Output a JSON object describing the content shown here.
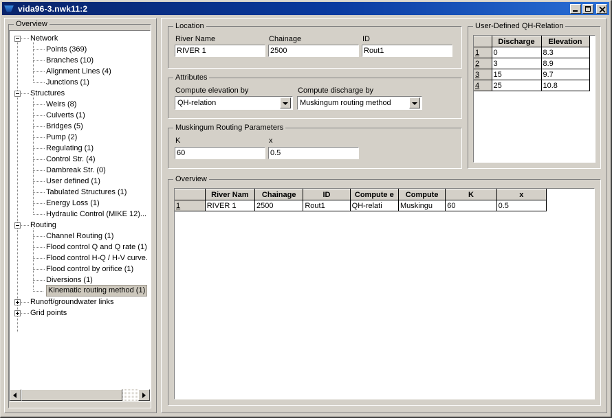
{
  "window": {
    "title": "vida96-3.nwk11:2",
    "icon": "app-icon",
    "buttons": {
      "minimize": "_",
      "maximize": "□",
      "close": "×"
    }
  },
  "overview_panel": {
    "title": "Overview",
    "tree": [
      {
        "label": "Network",
        "level": 0,
        "toggle": "minus"
      },
      {
        "label": "Points (369)",
        "level": 1,
        "toggle": "none"
      },
      {
        "label": "Branches (10)",
        "level": 1,
        "toggle": "none"
      },
      {
        "label": "Alignment Lines (4)",
        "level": 1,
        "toggle": "none"
      },
      {
        "label": "Junctions (1)",
        "level": 1,
        "toggle": "none"
      },
      {
        "label": "Structures",
        "level": 0,
        "toggle": "minus"
      },
      {
        "label": "Weirs (8)",
        "level": 1,
        "toggle": "none"
      },
      {
        "label": "Culverts (1)",
        "level": 1,
        "toggle": "none"
      },
      {
        "label": "Bridges (5)",
        "level": 1,
        "toggle": "none"
      },
      {
        "label": "Pump (2)",
        "level": 1,
        "toggle": "none"
      },
      {
        "label": "Regulating (1)",
        "level": 1,
        "toggle": "none"
      },
      {
        "label": "Control Str. (4)",
        "level": 1,
        "toggle": "none"
      },
      {
        "label": "Dambreak Str. (0)",
        "level": 1,
        "toggle": "none"
      },
      {
        "label": "User defined (1)",
        "level": 1,
        "toggle": "none"
      },
      {
        "label": "Tabulated Structures (1)",
        "level": 1,
        "toggle": "none"
      },
      {
        "label": "Energy Loss (1)",
        "level": 1,
        "toggle": "none"
      },
      {
        "label": "Hydraulic Control (MIKE 12)...",
        "level": 1,
        "toggle": "none"
      },
      {
        "label": "Routing",
        "level": 0,
        "toggle": "minus"
      },
      {
        "label": "Channel Routing (1)",
        "level": 1,
        "toggle": "none"
      },
      {
        "label": "Flood control Q and Q rate (1)",
        "level": 1,
        "toggle": "none"
      },
      {
        "label": "Flood control H-Q / H-V curve.",
        "level": 1,
        "toggle": "none"
      },
      {
        "label": "Flood control by orifice (1)",
        "level": 1,
        "toggle": "none"
      },
      {
        "label": "Diversions (1)",
        "level": 1,
        "toggle": "none"
      },
      {
        "label": "Kinematic routing method (1)",
        "level": 1,
        "toggle": "none",
        "selected": true
      },
      {
        "label": "Runoff/groundwater links",
        "level": 0,
        "toggle": "plus"
      },
      {
        "label": "Grid points",
        "level": 0,
        "toggle": "plus"
      }
    ],
    "scrollbar": {
      "left_arrow": "◄",
      "right_arrow": "►"
    }
  },
  "location": {
    "title": "Location",
    "river_name_label": "River Name",
    "river_name_value": "RIVER 1",
    "chainage_label": "Chainage",
    "chainage_value": "2500",
    "id_label": "ID",
    "id_value": "Rout1"
  },
  "attributes": {
    "title": "Attributes",
    "compute_elevation_label": "Compute elevation by",
    "compute_elevation_value": "QH-relation",
    "compute_discharge_label": "Compute discharge by",
    "compute_discharge_value": "Muskingum routing method"
  },
  "muskingum": {
    "title": "Muskingum Routing Parameters",
    "k_label": "K",
    "k_value": "60",
    "x_label": "x",
    "x_value": "0.5"
  },
  "qh_relation": {
    "title": "User-Defined QH-Relation",
    "columns": [
      "",
      "Discharge",
      "Elevation"
    ],
    "rows": [
      {
        "n": "1",
        "discharge": "0",
        "elevation": "8.3"
      },
      {
        "n": "2",
        "discharge": "3",
        "elevation": "8.9"
      },
      {
        "n": "3",
        "discharge": "15",
        "elevation": "9.7"
      },
      {
        "n": "4",
        "discharge": "25",
        "elevation": "10.8"
      }
    ]
  },
  "overview_table": {
    "title": "Overview",
    "columns": [
      "",
      "River Nam",
      "Chainage",
      "ID",
      "Compute e",
      "Compute",
      "K",
      "x"
    ],
    "rows": [
      {
        "n": "1",
        "river_name": "RIVER 1",
        "chainage": "2500",
        "id": "Rout1",
        "compute_elevation": "QH-relati",
        "compute_discharge": "Muskingu",
        "k": "60",
        "x": "0.5"
      }
    ]
  },
  "colors": {
    "face": "#d4d0c8",
    "titlebar_start": "#0a246a",
    "titlebar_end": "#2a6fd6",
    "selection": "#cdc8bd"
  }
}
